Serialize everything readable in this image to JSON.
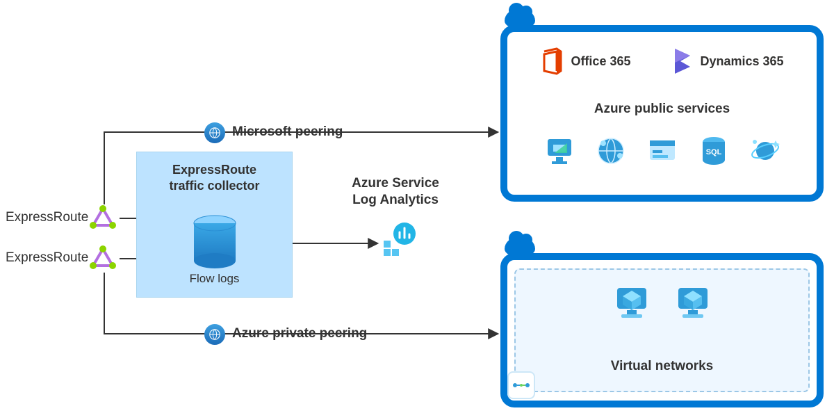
{
  "left": {
    "circuit1": "ExpressRoute",
    "circuit2": "ExpressRoute"
  },
  "peering": {
    "microsoft": "Microsoft peering",
    "private": "Azure private peering"
  },
  "collector": {
    "title_l1": "ExpressRoute",
    "title_l2": "traffic collector",
    "flowlogs": "Flow logs"
  },
  "analytics": {
    "title_l1": "Azure Service",
    "title_l2": "Log Analytics"
  },
  "cloud_top": {
    "office": "Office 365",
    "dynamics": "Dynamics 365",
    "subtitle": "Azure public services"
  },
  "cloud_bot": {
    "title": "Virtual networks"
  },
  "icons": {
    "office365": "office-365-icon",
    "dynamics365": "dynamics-365-icon",
    "vm_monitor": "azure-monitor-icon",
    "globe_net": "globe-network-icon",
    "webapp": "app-service-icon",
    "sql": "sql-database-icon",
    "cosmos": "cosmos-db-icon",
    "vm": "virtual-machine-icon",
    "vnet_badge": "vnet-peering-icon",
    "peering_globe": "peering-globe-icon",
    "log_analytics": "log-analytics-icon",
    "flow_db": "database-cylinder-icon",
    "expressroute": "expressroute-circuit-icon",
    "cloud": "cloud-icon"
  }
}
